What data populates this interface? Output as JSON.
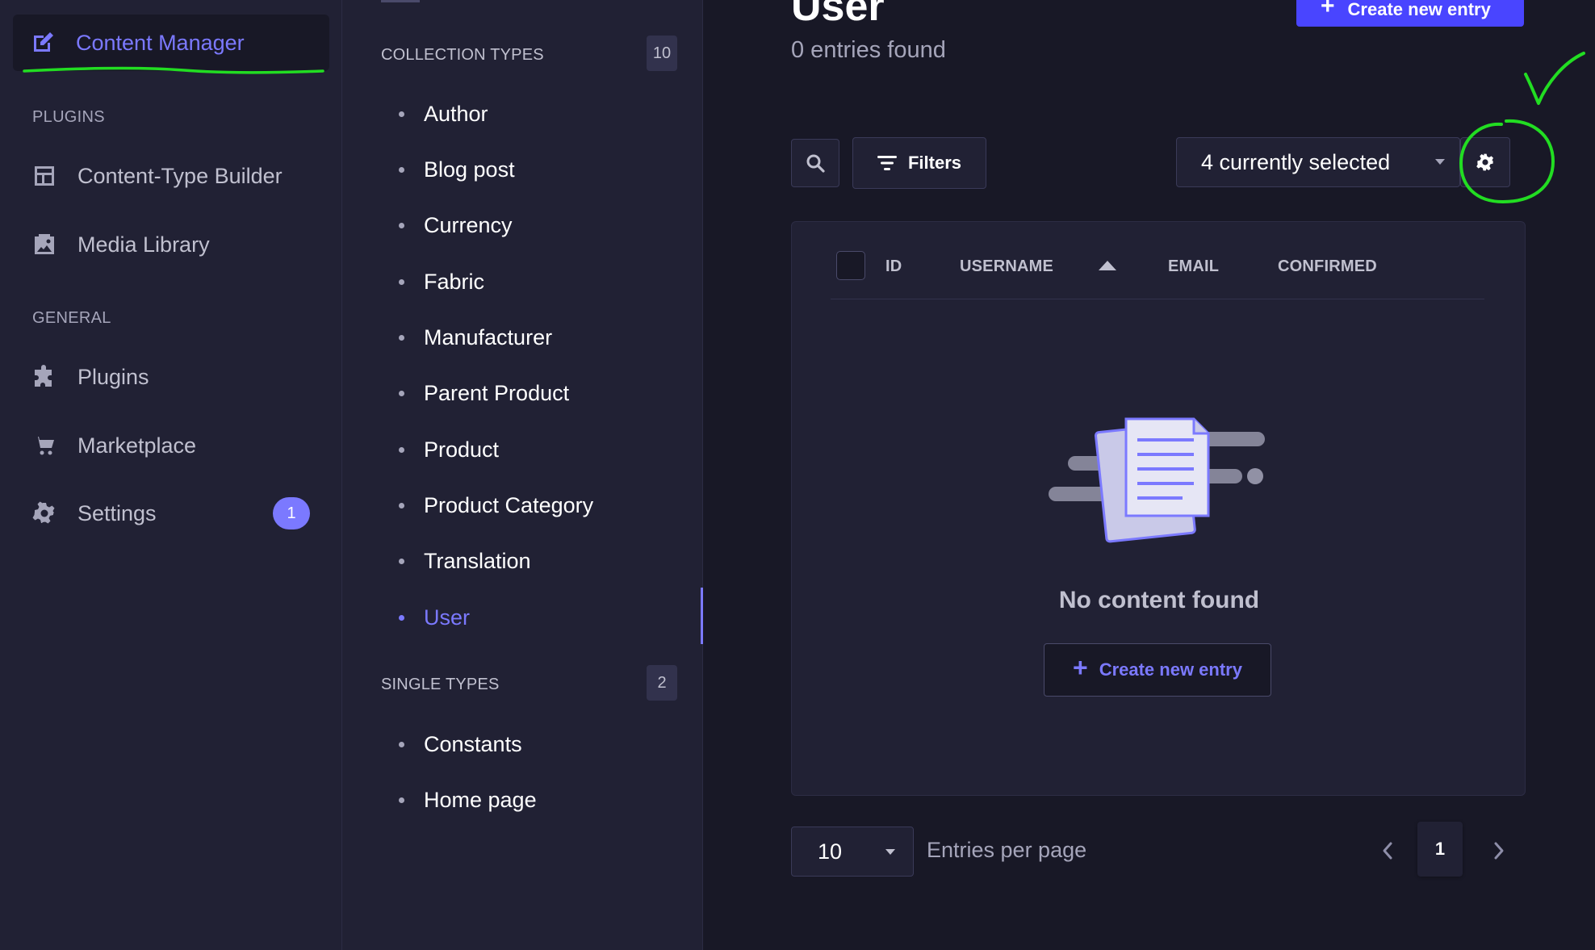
{
  "sidebar": {
    "active_item": {
      "label": "Content Manager",
      "icon": "pencil-note-icon"
    },
    "sections": {
      "plugins": "PLUGINS",
      "general": "GENERAL"
    },
    "plugins_items": [
      {
        "label": "Content-Type Builder",
        "icon": "layout-icon"
      },
      {
        "label": "Media Library",
        "icon": "image-icon"
      }
    ],
    "general_items": [
      {
        "label": "Plugins",
        "icon": "puzzle-icon"
      },
      {
        "label": "Marketplace",
        "icon": "cart-icon"
      },
      {
        "label": "Settings",
        "icon": "gear-icon",
        "badge": "1"
      }
    ]
  },
  "content_types": {
    "collection_title": "COLLECTION TYPES",
    "collection_count": "10",
    "collection_items": [
      "Author",
      "Blog post",
      "Currency",
      "Fabric",
      "Manufacturer",
      "Parent Product",
      "Product",
      "Product Category",
      "Translation",
      "User"
    ],
    "active_collection": "User",
    "single_title": "SINGLE TYPES",
    "single_count": "2",
    "single_items": [
      "Constants",
      "Home page"
    ]
  },
  "main": {
    "title": "User",
    "entries_found": "0 entries found",
    "create_button": "Create new entry",
    "filters_label": "Filters",
    "columns_select": "4 currently selected",
    "table_headers": [
      "ID",
      "USERNAME",
      "EMAIL",
      "CONFIRMED"
    ],
    "empty_message": "No content found",
    "empty_create_button": "Create new entry",
    "per_page_value": "10",
    "per_page_label": "Entries per page",
    "current_page": "1"
  },
  "colors": {
    "accent": "#7b79ff",
    "primary_button": "#4945ff",
    "background": "#181826",
    "panel": "#212134",
    "annotation_green": "#22dd22"
  }
}
